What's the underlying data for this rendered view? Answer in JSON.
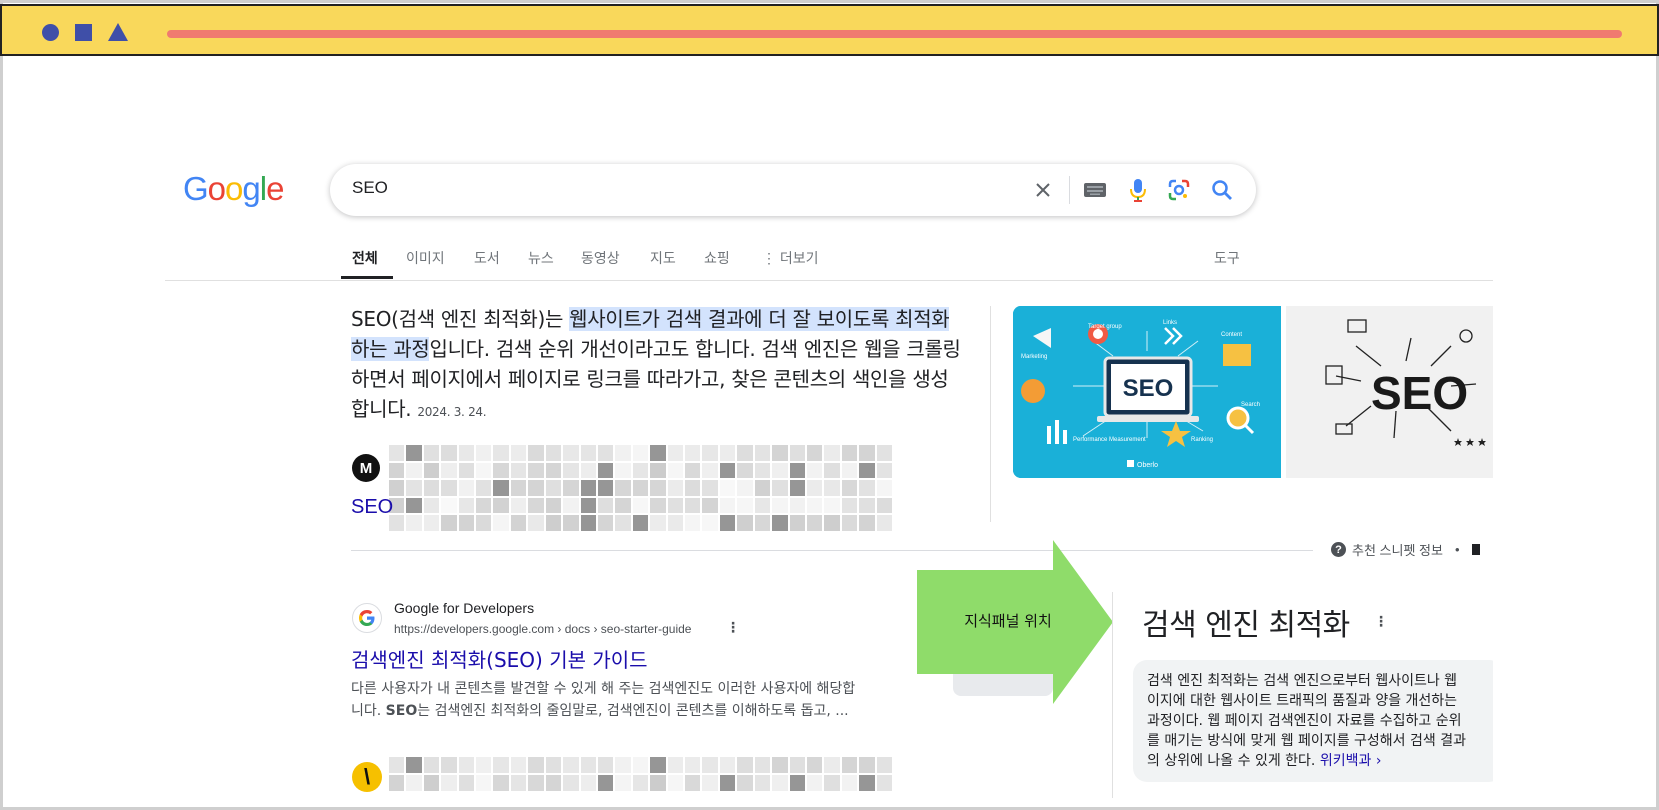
{
  "search": {
    "query": "SEO"
  },
  "logo": {
    "letters": [
      "G",
      "o",
      "o",
      "g",
      "l",
      "e"
    ],
    "colors": [
      "#4285f4",
      "#ea4335",
      "#fbbc05",
      "#4285f4",
      "#34a853",
      "#ea4335"
    ]
  },
  "tabs": {
    "items": [
      "전체",
      "이미지",
      "도서",
      "뉴스",
      "동영상",
      "지도",
      "쇼핑",
      "⋮ 더보기"
    ],
    "tools": "도구"
  },
  "snippet": {
    "text_before": "SEO(검색 엔진 최적화)는 ",
    "highlight": "웹사이트가 검색 결과에 더 잘 보이도록 최적화하는 과정",
    "text_after": "입니다. 검색 순위 개선이라고도 합니다. 검색 엔진은 웹을 크롤링하면서 페이지에서 페이지로 링크를 따라가고, 찾은 콘텐츠의 색인을 생성합니다.",
    "date": "2024. 3. 24.",
    "source_avatar": "M",
    "source_link": "SEO",
    "info_label": "추천 스니펫 정보",
    "info_separator": "•"
  },
  "images": {
    "image1": {
      "main_label": "SEO",
      "labels": [
        "Target group",
        "Links",
        "Content",
        "Marketing",
        "Performance Measurement",
        "Ranking",
        "Search"
      ],
      "brand": "Oberlo",
      "bg_color": "#1ab0d8"
    },
    "image2": {
      "main_label": "SEO"
    }
  },
  "result": {
    "favicon": "G",
    "site_name": "Google for Developers",
    "url": "https://developers.google.com › docs › seo-starter-guide",
    "title": "검색엔진 최적화(SEO) 기본 가이드",
    "desc_line1": "다른 사용자가 내 콘텐츠를 발견할 수 있게 해 주는 검색엔진도 이러한 사용자에 해당합",
    "desc_line2_prefix": "니다. ",
    "desc_line2_bold": "SEO",
    "desc_line2_rest": "는 검색엔진 최적화의 줄임말로, 검색엔진이 콘텐츠를 이해하도록 돕고, ...",
    "second_avatar": "\\"
  },
  "annotation": {
    "label": "지식패널 위치",
    "color": "#8fdc6a"
  },
  "knowledge_panel": {
    "title": "검색 엔진 최적화",
    "lines": [
      "검색 엔진 최적화는 검색 엔진으로부터 웹사이트나 웹",
      "이지에 대한 웹사이트 트래픽의 품질과 양을 개선하는",
      "과정이다. 웹 페이지 검색엔진이 자료를 수집하고 순위",
      "를 매기는 방식에 맞게 웹 페이지를 구성해서 검색 결과",
      "의 상위에 나올 수 있게 한다."
    ],
    "link": "위키백과 ›"
  },
  "frame": {
    "topbar_color": "#f9d85b",
    "line_color": "#f07a70",
    "shape_color": "#3f4fa8"
  }
}
